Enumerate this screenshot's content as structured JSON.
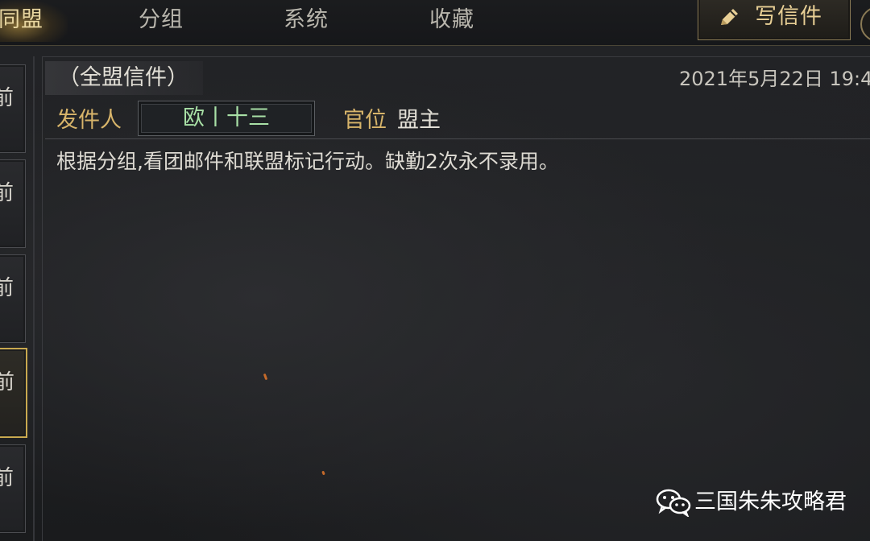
{
  "tabs": [
    {
      "label": "同盟",
      "active": true
    },
    {
      "label": "分组",
      "active": false
    },
    {
      "label": "系统",
      "active": false
    },
    {
      "label": "收藏",
      "active": false
    }
  ],
  "write_button": {
    "label": "写信件",
    "icon": "pencil-icon"
  },
  "left_rail": {
    "items": [
      {
        "label": "前",
        "selected": false
      },
      {
        "label": "前",
        "selected": false
      },
      {
        "label": "前",
        "selected": false
      },
      {
        "label": "前",
        "selected": true
      },
      {
        "label": "前",
        "selected": false
      }
    ]
  },
  "mail": {
    "title": "（全盟信件）",
    "date": "2021年5月22日 19:4",
    "sender_label": "发件人",
    "sender_name": "欧丨十三",
    "rank_label": "官位",
    "rank_value": "盟主",
    "body": "根据分组,看团邮件和联盟标记行动。缺勤2次永不录用。"
  },
  "watermark": {
    "text": "三国朱朱攻略君",
    "icon": "wechat-icon"
  },
  "colors": {
    "accent_gold": "#d7b46a",
    "sender_green": "#a8e0a6",
    "background": "#1c1d1f"
  }
}
